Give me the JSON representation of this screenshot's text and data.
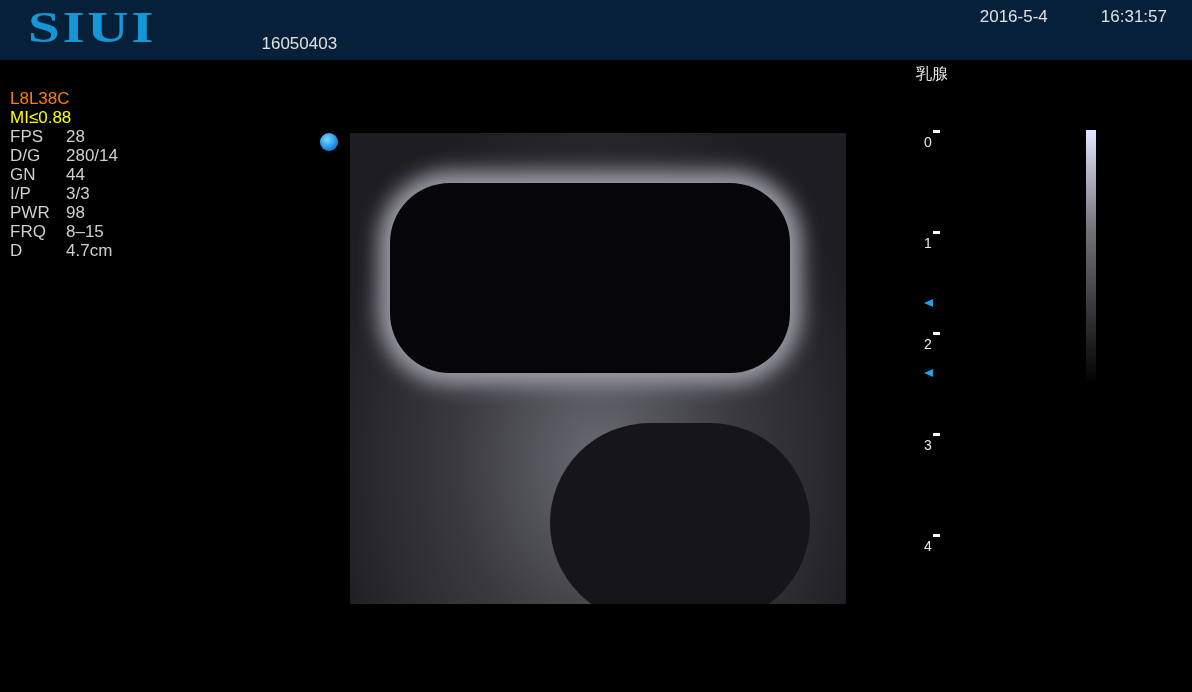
{
  "header": {
    "logo": "SIUI",
    "patient_id": "16050403",
    "date": "2016-5-4",
    "time": "16:31:57"
  },
  "probe": "L8L38C",
  "mi": "MI≤0.88",
  "parameters": [
    {
      "label": "FPS",
      "value": "28"
    },
    {
      "label": "D/G",
      "value": "280/14"
    },
    {
      "label": "GN",
      "value": "44"
    },
    {
      "label": "I/P",
      "value": "3/3"
    },
    {
      "label": "PWR",
      "value": "98"
    },
    {
      "label": "FRQ",
      "value": "8–15"
    },
    {
      "label": "D",
      "value": "4.7cm"
    }
  ],
  "preset": "乳腺",
  "depth_scale": [
    "0",
    "1",
    "2",
    "3",
    "4"
  ]
}
